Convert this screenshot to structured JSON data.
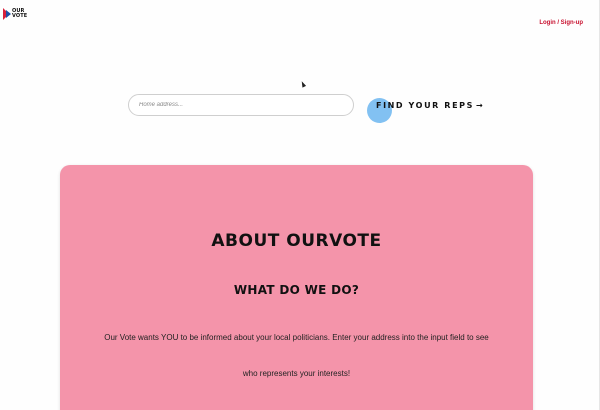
{
  "header": {
    "logo_text_line1": "OUR",
    "logo_text_line2": "VOTE",
    "login_label": "Login / Sign-up"
  },
  "search": {
    "placeholder": "Home address...",
    "button_label": "FIND YOUR REPS",
    "button_arrow": "→"
  },
  "about": {
    "title": "ABOUT OURVOTE",
    "subtitle": "WHAT DO WE DO?",
    "text_line1": "Our Vote wants YOU to be informed about your local politicians. Enter your address into the input field to see",
    "text_line2": "who represents your interests!"
  },
  "colors": {
    "accent_red": "#c8102e",
    "logo_blue": "#1e4fa3",
    "card_pink": "#f494aa",
    "click_highlight": "#58acee"
  },
  "icons": {
    "logo": "ourvote-chevron-logo",
    "button_arrow": "arrow-right-icon",
    "cursor": "mouse-pointer-icon"
  }
}
